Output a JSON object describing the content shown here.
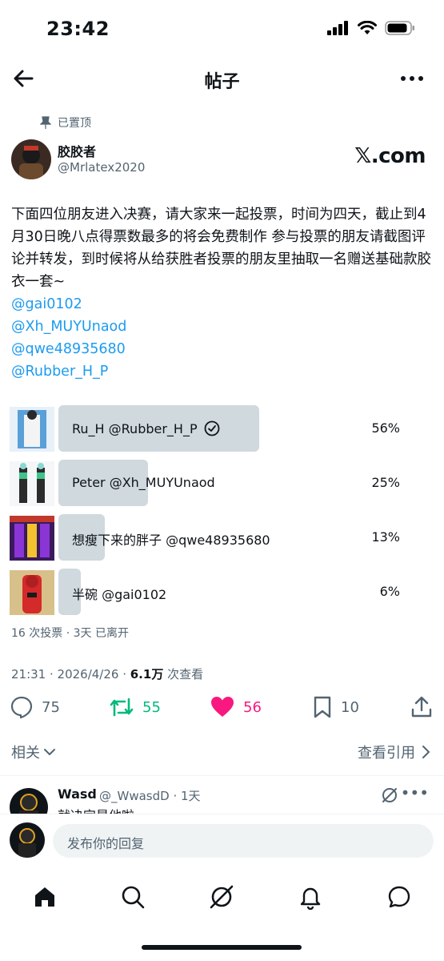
{
  "status": {
    "time": "23:42"
  },
  "nav": {
    "title": "帖子"
  },
  "post": {
    "pinned_label": "已置顶",
    "author_name": "胶胶者",
    "author_handle": "@Mrlatex2020",
    "badge": "𝕏.com",
    "text": "下面四位朋友进入决赛，请大家来一起投票，时间为四天，截止到4月30日晚八点得票数最多的将会免费制作 参与投票的朋友请截图评论并转发，到时候将从给获胜者投票的朋友里抽取一名赠送基础款胶衣一套~",
    "mentions": [
      "@gai0102",
      "@Xh_MUYUnaod",
      "@qwe48935680",
      "@Rubber_H_P"
    ]
  },
  "poll": {
    "options": [
      {
        "label": "Ru_H @Rubber_H_P",
        "percent": "56%",
        "fraction": 0.56,
        "selected": true
      },
      {
        "label": "Peter @Xh_MUYUnaod",
        "percent": "25%",
        "fraction": 0.25,
        "selected": false
      },
      {
        "label": "想瘦下来的胖子 @qwe48935680",
        "percent": "13%",
        "fraction": 0.13,
        "selected": false
      },
      {
        "label": "半碗 @gai0102",
        "percent": "6%",
        "fraction": 0.06,
        "selected": false
      }
    ],
    "meta": "16 次投票 · 3天 已离开"
  },
  "timestamp": {
    "time": "21:31 · 2026/4/26 · ",
    "views_count": "6.1万",
    "views_label": " 次查看"
  },
  "actions": {
    "replies": "75",
    "reposts": "55",
    "likes": "56",
    "bookmarks": "10"
  },
  "links": {
    "related": "相关",
    "quotes": "查看引用"
  },
  "reply": {
    "name": "Wasd",
    "handle": "@_WwasdD · 1天",
    "text": "就决定是他啦",
    "more": "•••"
  },
  "composer": {
    "placeholder": "发布你的回复"
  },
  "colors": {
    "accent": "#1d9bf0",
    "repost": "#00ba7c",
    "like": "#f91880",
    "bar": "#cfd9de"
  }
}
